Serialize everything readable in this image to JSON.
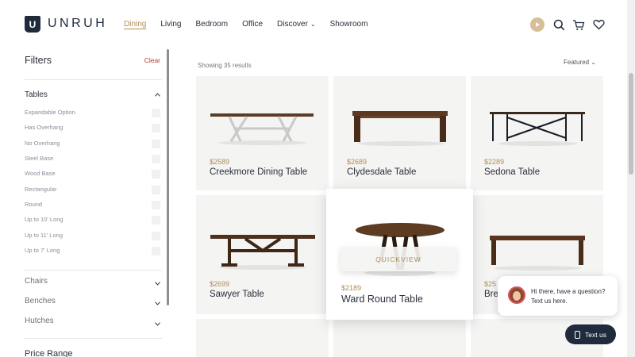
{
  "brand": {
    "logo_letter": "U",
    "name": "UNRUH"
  },
  "nav": [
    {
      "label": "Dining",
      "active": true
    },
    {
      "label": "Living"
    },
    {
      "label": "Bedroom"
    },
    {
      "label": "Office"
    },
    {
      "label": "Discover",
      "chevron": "⌄"
    },
    {
      "label": "Showroom"
    }
  ],
  "header_icons": [
    "play-icon",
    "search-icon",
    "cart-icon",
    "heart-icon"
  ],
  "sidebar": {
    "title": "Filters",
    "clear": "Clear",
    "tables": {
      "label": "Tables",
      "expanded": true,
      "options": [
        "Expandable Option",
        "Has Overhang",
        "No Overhang",
        "Steel Base",
        "Wood Base",
        "Rectangular",
        "Round",
        "Up to 10' Long",
        "Up to 11' Long",
        "Up to 7' Long"
      ]
    },
    "collapsed_sections": [
      "Chairs",
      "Benches",
      "Hutches"
    ],
    "price_range": "Price Range"
  },
  "results": {
    "showing": "Showing 35 results",
    "sort": "Featured"
  },
  "products": [
    {
      "price": "$2589",
      "name": "Creekmore Dining Table"
    },
    {
      "price": "$2689",
      "name": "Clydesdale Table"
    },
    {
      "price": "$2289",
      "name": "Sedona Table"
    },
    {
      "price": "$2699",
      "name": "Sawyer Table"
    },
    {
      "price": "$2189",
      "name": "Ward Round Table",
      "quickview": "QUICKVIEW"
    },
    {
      "price": "$25",
      "name": "Bre"
    }
  ],
  "chat": {
    "message": "Hi there, have a question? Text us here.",
    "button": "Text us"
  },
  "colors": {
    "accent": "#b08d57",
    "navy": "#1f2a3c",
    "clear_red": "#c0392b",
    "card_bg": "#f4f4f3"
  }
}
